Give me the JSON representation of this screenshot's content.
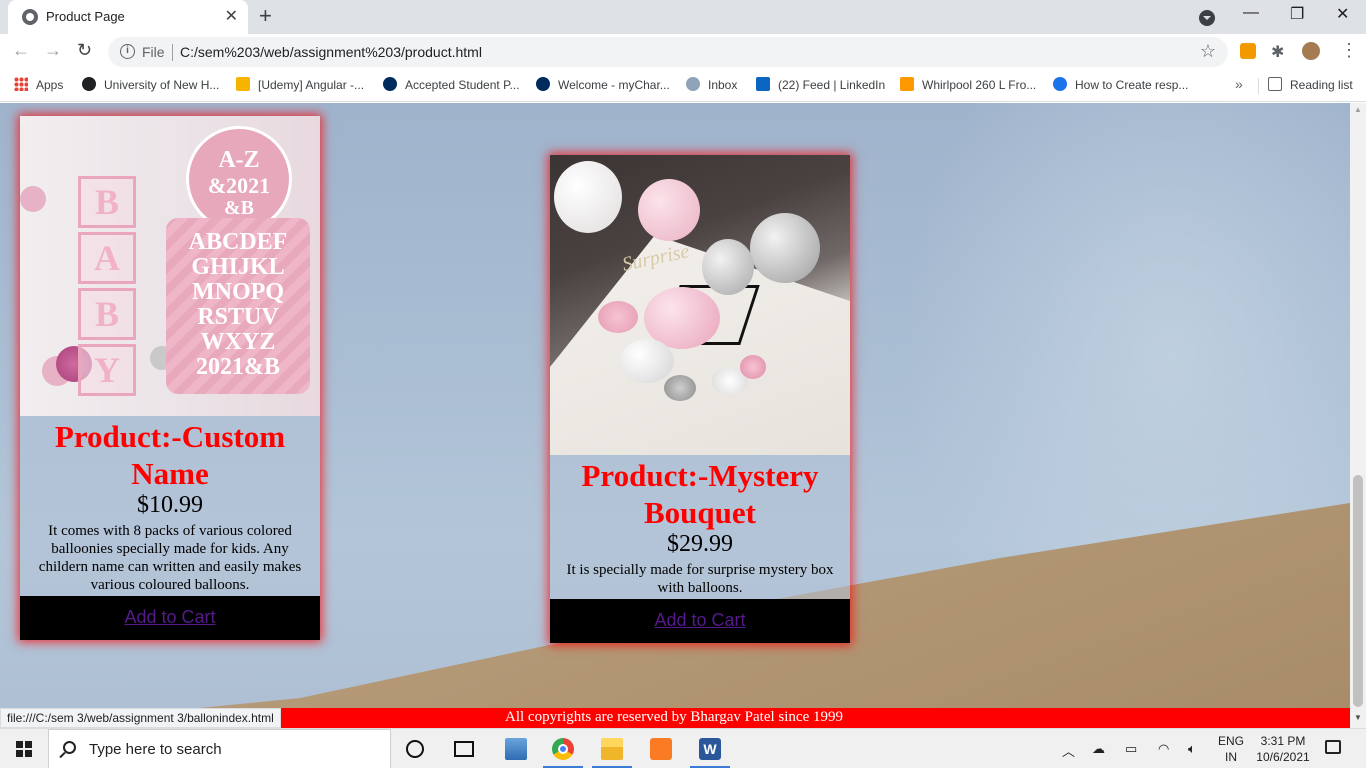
{
  "browser": {
    "tab_title": "Product Page",
    "tab_close": "✕",
    "new_tab": "+",
    "window_controls": {
      "minimize": "—",
      "maximize": "❐",
      "close": "✕"
    },
    "nav": {
      "back": "←",
      "forward": "→",
      "reload": "↻"
    },
    "address": {
      "scheme_label": "File",
      "url": "C:/sem%203/web/assignment%203/product.html"
    },
    "bookmarks": [
      {
        "label": "Apps"
      },
      {
        "label": "University of New H..."
      },
      {
        "label": "[Udemy] Angular -..."
      },
      {
        "label": "Accepted Student P..."
      },
      {
        "label": "Welcome - myChar..."
      },
      {
        "label": "Inbox"
      },
      {
        "label": "(22) Feed | LinkedIn"
      },
      {
        "label": "Whirlpool 260 L Fro..."
      },
      {
        "label": "How to Create resp..."
      }
    ],
    "bookmarks_more": "»",
    "reading_list": "Reading list",
    "status_url": "file:///C:/sem 3/web/assignment 3/ballonindex.html"
  },
  "page": {
    "products": [
      {
        "name": "Product:-Custom Name",
        "price": "$10.99",
        "description": "It comes with 8 packs of various colored balloonies specially made for kids. Any childern name can written and easily makes various coloured balloons.",
        "cart_label": "Add to Cart",
        "image_text": {
          "boxes": [
            "B",
            "A",
            "B",
            "Y"
          ],
          "badge_top": "A-Z",
          "badge_mid": "&2021",
          "badge_bot": "&B",
          "panel": [
            "ABCDEF",
            "GHIJKL",
            "MNOPQ",
            "RSTUV",
            "WXYZ",
            "2021&B"
          ]
        }
      },
      {
        "name": "Product:-Mystery Bouquet",
        "price": "$29.99",
        "description": "It is specially made for surprise mystery box with balloons.",
        "cart_label": "Add to Cart",
        "image_text": {
          "script": "Surprise"
        }
      }
    ],
    "footer": "All copyrights are reserved by Bhargav Patel since 1999"
  },
  "taskbar": {
    "search_placeholder": "Type here to search",
    "lang_top": "ENG",
    "lang_bottom": "IN",
    "time": "3:31 PM",
    "date": "10/6/2021",
    "word_letter": "W"
  },
  "colors": {
    "product_title": "#ff0000",
    "footer_bg": "#ff0000",
    "card_glow": "#ff0000",
    "cart_bg": "#000000",
    "link": "#551a8b"
  }
}
